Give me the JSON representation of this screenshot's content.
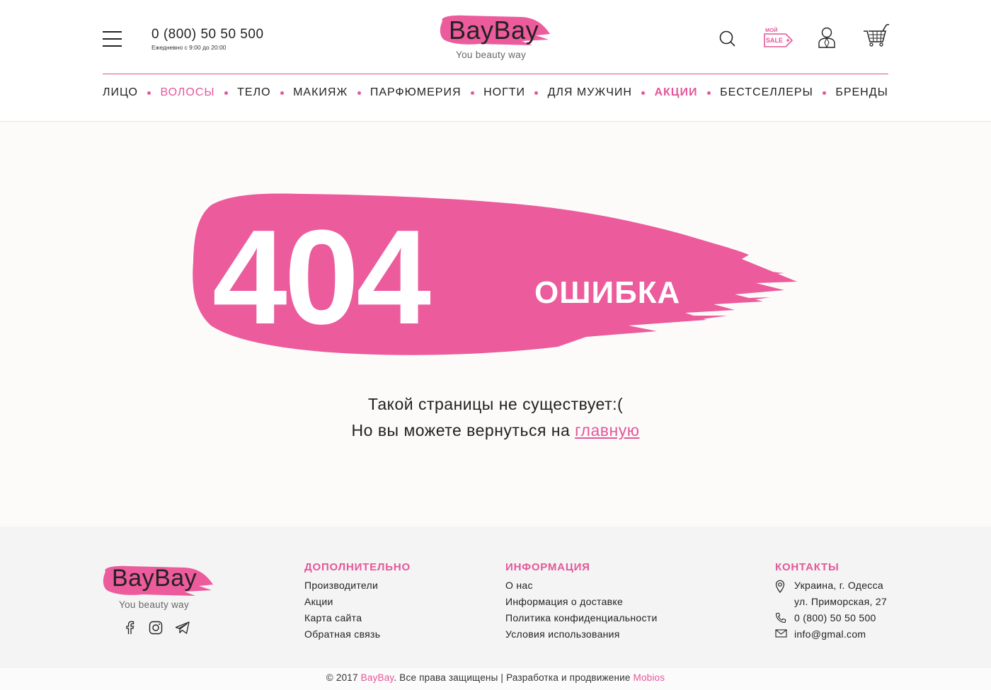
{
  "header": {
    "phone": "0 (800) 50 50 500",
    "hours": "Ежедневно с 9:00 до 20:00",
    "logo_text": "BayBay",
    "logo_subtitle": "You beauty way",
    "sale_badge_top": "МОЙ",
    "sale_badge_bottom": "SALE",
    "icons": [
      "menu-icon",
      "search-icon",
      "sale-tag-icon",
      "user-icon",
      "cart-icon"
    ]
  },
  "nav": {
    "items": [
      {
        "label": "ЛИЦО"
      },
      {
        "label": "ВОЛОСЫ"
      },
      {
        "label": "ТЕЛО"
      },
      {
        "label": "МАКИЯЖ"
      },
      {
        "label": "ПАРФЮМЕРИЯ"
      },
      {
        "label": "НОГТИ"
      },
      {
        "label": "ДЛЯ МУЖЧИН"
      },
      {
        "label": "АКЦИИ"
      },
      {
        "label": "БЕСТСЕЛЛЕРЫ"
      },
      {
        "label": "БРЕНДЫ"
      }
    ]
  },
  "error": {
    "code": "404",
    "word": "ОШИБКА",
    "message_line1": "Такой страницы не существует:(",
    "message_line2_prefix": "Но вы можете вернуться на ",
    "home_link": "главную"
  },
  "footer": {
    "logo_text": "BayBay",
    "logo_subtitle": "You beauty way",
    "social": [
      "facebook-icon",
      "instagram-icon",
      "telegram-icon"
    ],
    "col1": {
      "title": "ДОПОЛНИТЕЛЬНО",
      "links": [
        "Производители",
        "Акции",
        "Карта сайта",
        "Обратная связь"
      ]
    },
    "col2": {
      "title": "ИНФОРМАЦИЯ",
      "links": [
        "О нас",
        "Информация о доставке",
        "Политика конфиденциальности",
        "Условия использования"
      ]
    },
    "col3": {
      "title": "КОНТАКТЫ",
      "address_line1": "Украина, г. Одесса",
      "address_line2": "ул. Приморская, 27",
      "phone": "0 (800) 50 50 500",
      "email": "info@gmal.com"
    },
    "copyright_prefix": "© 2017 ",
    "copyright_brand": "BayBay",
    "copyright_middle": ". Все права защищены | Разработка и продвижение ",
    "copyright_dev": "Mobios"
  },
  "colors": {
    "accent": "#e4579a",
    "brush": "#ec5b9c",
    "main_bg": "#fcfbf9",
    "footer_bg": "#f4f4f4"
  }
}
